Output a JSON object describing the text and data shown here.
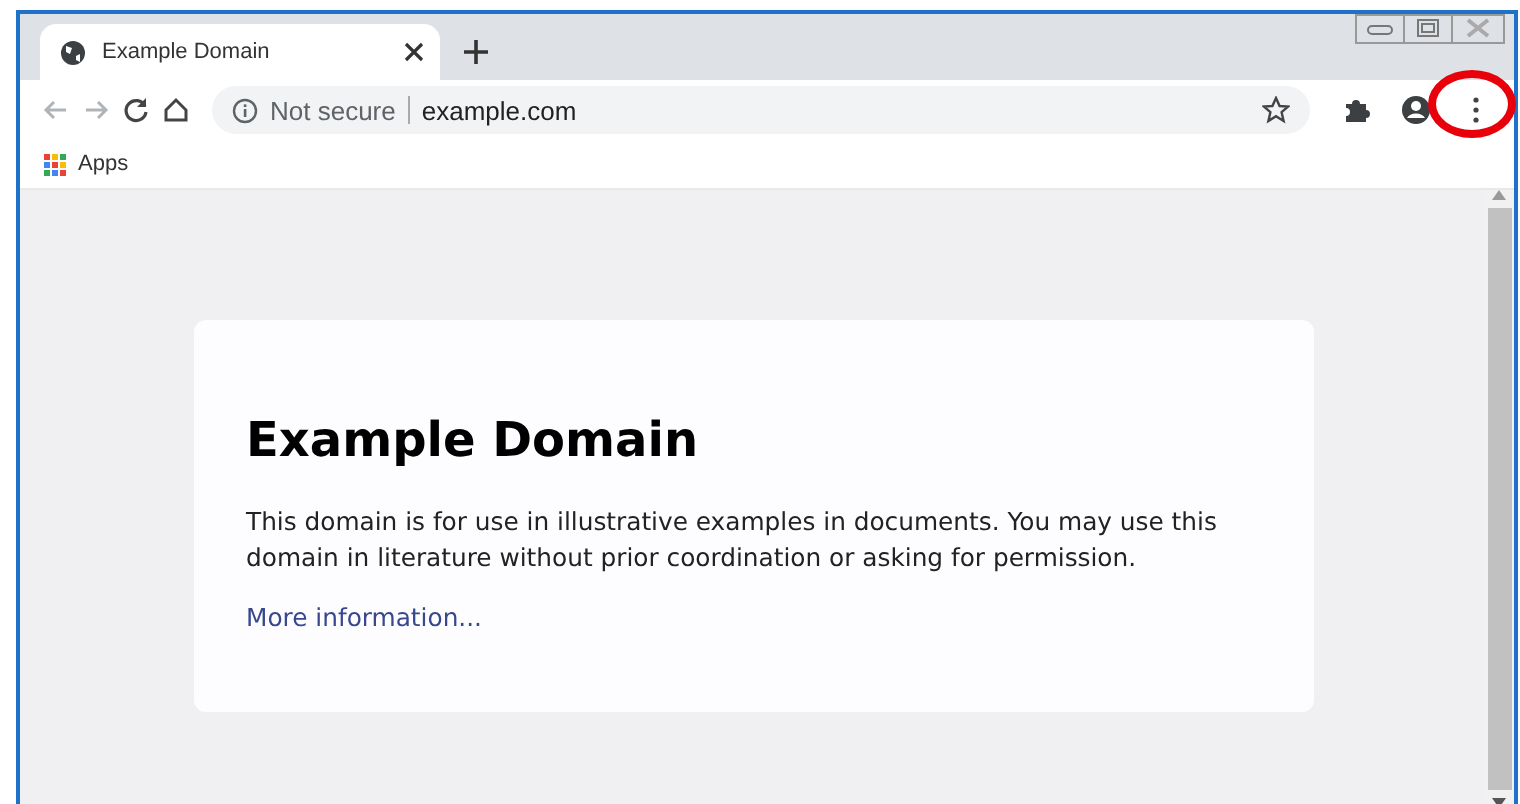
{
  "tabs": [
    {
      "title": "Example Domain",
      "selected": true
    }
  ],
  "toolbar": {
    "nav": [
      {
        "kind": "back",
        "disabled": true
      },
      {
        "kind": "forward",
        "disabled": true
      },
      {
        "kind": "reload",
        "disabled": false
      },
      {
        "kind": "home",
        "disabled": false
      }
    ],
    "address": {
      "security": "Not secure",
      "url": "example.com"
    },
    "actions": [
      {
        "kind": "star",
        "highlighted": false
      },
      {
        "kind": "extensions",
        "highlighted": false
      },
      {
        "kind": "profile",
        "highlighted": false
      },
      {
        "kind": "menu",
        "highlighted": true
      }
    ]
  },
  "bookmarks": [
    {
      "kind": "apps",
      "label": "Apps"
    }
  ],
  "page": {
    "heading": "Example Domain",
    "paragraph": "This domain is for use in illustrative examples in documents. You may use this domain in literature without prior coordination or asking for permission.",
    "link": "More information..."
  }
}
